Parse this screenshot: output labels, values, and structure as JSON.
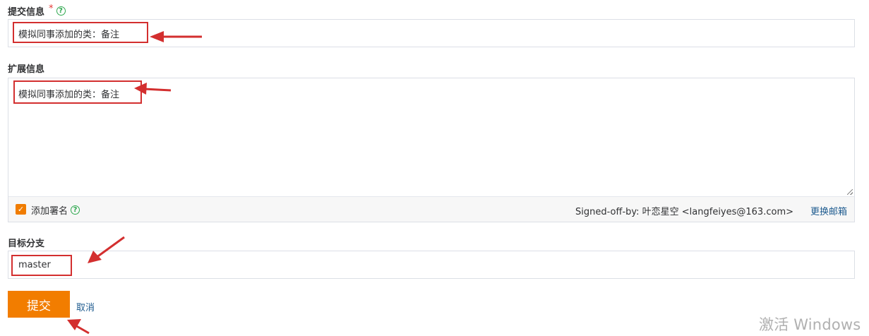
{
  "commit_message": {
    "label": "提交信息",
    "required_mark": "*",
    "value": "模拟同事添加的类：备注"
  },
  "extended_info": {
    "label": "扩展信息",
    "value": "模拟同事添加的类：备注"
  },
  "signature": {
    "checkbox_label": "添加署名",
    "checked": true,
    "signed_off_text": "Signed-off-by: 叶恋星空 <langfeiyes@163.com>",
    "change_email_label": "更换邮箱"
  },
  "target_branch": {
    "label": "目标分支",
    "value": "master"
  },
  "actions": {
    "submit_label": "提交",
    "cancel_label": "取消"
  },
  "watermark": {
    "text": "激活 Windows"
  },
  "colors": {
    "accent": "#f27d00",
    "link": "#1e5b8f",
    "annotation": "#d32f2f",
    "help": "#2fa84f"
  }
}
